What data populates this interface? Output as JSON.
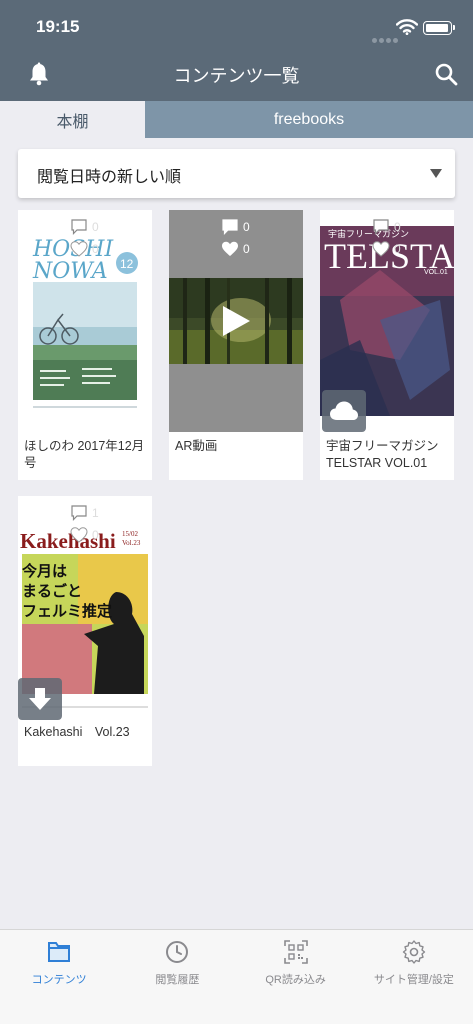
{
  "status_bar": {
    "time": "19:15"
  },
  "nav": {
    "title": "コンテンツ一覧"
  },
  "tabs": [
    {
      "label": "本棚",
      "active": true
    },
    {
      "label": "freebooks",
      "active": false
    }
  ],
  "sort": {
    "selected": "閲覧日時の新しい順"
  },
  "cards": [
    {
      "title": "ほしのわ 2017年12月号",
      "comments": "0",
      "likes": "0",
      "badge": "none",
      "cover_text": "HOSHI NOWA",
      "cover_number": "12"
    },
    {
      "title": "AR動画",
      "comments": "0",
      "likes": "0",
      "badge": "none"
    },
    {
      "title": "宇宙フリーマガジン TELSTAR VOL.01",
      "comments": "0",
      "likes": "0",
      "badge": "cloud-icon",
      "cover_text": "TELSTAR",
      "cover_sub": "宇宙フリーマガジン",
      "cover_vol": "VOL.01"
    },
    {
      "title": "Kakehashi　Vol.23",
      "comments": "1",
      "likes": "0",
      "badge": "download-icon",
      "cover_text": "Kakehashi",
      "cover_vol": "15/02 Vol.23",
      "cover_headline": "今月は まるごと フェルミ推定"
    }
  ],
  "tab_bar": [
    {
      "label": "コンテンツ",
      "icon": "folder-icon",
      "active": true
    },
    {
      "label": "閲覧履歴",
      "icon": "clock-icon",
      "active": false
    },
    {
      "label": "QR読み込み",
      "icon": "qr-icon",
      "active": false
    },
    {
      "label": "サイト管理/設定",
      "icon": "gear-icon",
      "active": false
    }
  ],
  "colors": {
    "header": "#5b6a78",
    "tab_inactive": "#7e95a8",
    "accent": "#2f7fd6"
  }
}
